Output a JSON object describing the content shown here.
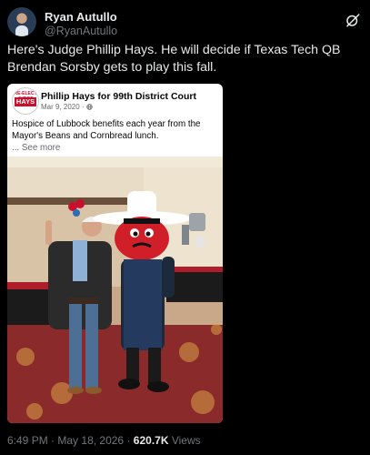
{
  "tweet": {
    "author_name": "Ryan Autullo",
    "author_handle": "@RyanAutullo",
    "text": "Here's Judge Phillip Hays. He will decide if Texas Tech QB Brendan Sorsby gets to play this fall.",
    "time": "6:49 PM",
    "date": "May 18, 2026",
    "views_count": "620.7K",
    "views_label": "Views",
    "separator": "·"
  },
  "embedded_post": {
    "logo_top": "RE-ELECT JUDGE PHILLIP",
    "logo_main": "HAYS",
    "page_name": "Phillip Hays for 99th District Court",
    "date": "Mar 9, 2020 ·",
    "body": "Hospice of Lubbock benefits each year from the Mayor's Beans and Cornbread lunch.",
    "see_more": "... See more",
    "privacy_icon": "globe-icon"
  },
  "icons": {
    "grok": "grok-icon"
  },
  "colors": {
    "background": "#000000",
    "text": "#e7e9ea",
    "muted": "#71767b",
    "brand_red": "#c8102e"
  }
}
